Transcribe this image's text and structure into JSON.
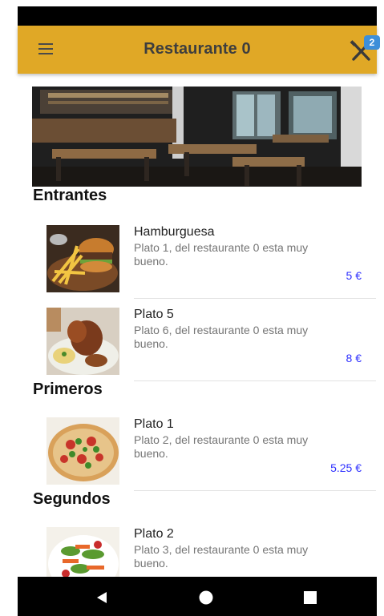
{
  "app_bar": {
    "title": "Restaurante 0",
    "menu_icon": "menu-icon",
    "cart_icon": "cutlery-icon",
    "cart_count": "2",
    "color": "#e0a826"
  },
  "sections": [
    {
      "title": "Entrantes",
      "items": [
        {
          "name": "Hamburguesa",
          "description": "Plato 1, del restaurante 0 esta muy bueno.",
          "price": "5 €"
        },
        {
          "name": "Plato 5",
          "description": "Plato 6, del restaurante 0 esta muy bueno.",
          "price": "8 €"
        }
      ]
    },
    {
      "title": "Primeros",
      "items": [
        {
          "name": "Plato 1",
          "description": "Plato 2, del restaurante 0 esta muy bueno.",
          "price": "5.25 €"
        }
      ]
    },
    {
      "title": "Segundos",
      "items": [
        {
          "name": "Plato 2",
          "description": "Plato 3, del restaurante 0 esta muy bueno.",
          "price": ""
        }
      ]
    }
  ],
  "nav": {
    "back_icon": "back-triangle-icon",
    "home_icon": "home-circle-icon",
    "recents_icon": "recents-square-icon"
  },
  "colors": {
    "price": "#2f31ff",
    "badge": "#3d8fd9"
  }
}
